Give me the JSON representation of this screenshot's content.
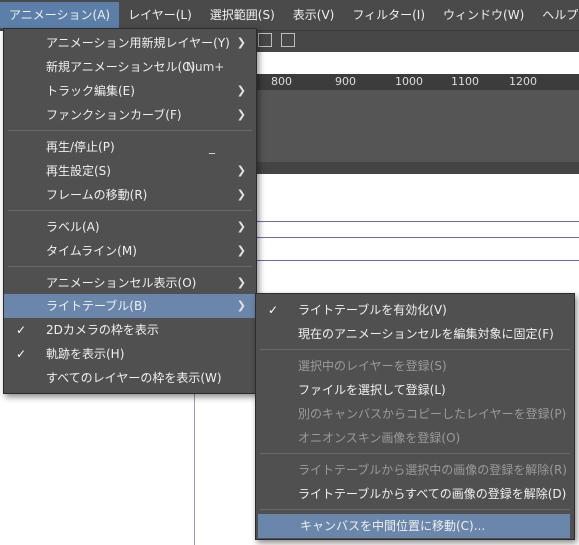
{
  "menubar": {
    "items": [
      "アニメーション(A)",
      "レイヤー(L)",
      "選択範囲(S)",
      "表示(V)",
      "フィルター(I)",
      "ウィンドウ(W)",
      "ヘルプ(H)"
    ]
  },
  "ruler": {
    "labels": [
      "800",
      "900",
      "1000",
      "1100",
      "1200"
    ]
  },
  "animation_menu": {
    "items": [
      {
        "label": "アニメーション用新規レイヤー(Y)",
        "submenu": true
      },
      {
        "label": "新規アニメーションセル(C)",
        "shortcut": "Num+"
      },
      {
        "label": "トラック編集(E)",
        "submenu": true
      },
      {
        "label": "ファンクションカーブ(F)",
        "submenu": true
      },
      {
        "label": "再生/停止(P)",
        "shortcut": "_"
      },
      {
        "label": "再生設定(S)",
        "submenu": true
      },
      {
        "label": "フレームの移動(R)",
        "submenu": true
      },
      {
        "label": "ラベル(A)",
        "submenu": true
      },
      {
        "label": "タイムライン(M)",
        "submenu": true
      },
      {
        "label": "アニメーションセル表示(O)",
        "submenu": true
      },
      {
        "label": "ライトテーブル(B)",
        "submenu": true
      },
      {
        "label": "2Dカメラの枠を表示",
        "checked": true
      },
      {
        "label": "軌跡を表示(H)",
        "checked": true
      },
      {
        "label": "すべてのレイヤーの枠を表示(W)"
      }
    ]
  },
  "lighttable_menu": {
    "items": [
      {
        "label": "ライトテーブルを有効化(V)",
        "checked": true
      },
      {
        "label": "現在のアニメーションセルを編集対象に固定(F)"
      },
      {
        "label": "選択中のレイヤーを登録(S)",
        "disabled": true
      },
      {
        "label": "ファイルを選択して登録(L)"
      },
      {
        "label": "別のキャンバスからコピーしたレイヤーを登録(P)",
        "disabled": true
      },
      {
        "label": "オニオンスキン画像を登録(O)",
        "disabled": true
      },
      {
        "label": "ライトテーブルから選択中の画像の登録を解除(R)",
        "disabled": true
      },
      {
        "label": "ライトテーブルからすべての画像の登録を解除(D)"
      },
      {
        "label": "キャンバスを中間位置に移動(C)..."
      }
    ]
  },
  "icons": {
    "check": "✓",
    "submenu_arrow": "❯"
  }
}
